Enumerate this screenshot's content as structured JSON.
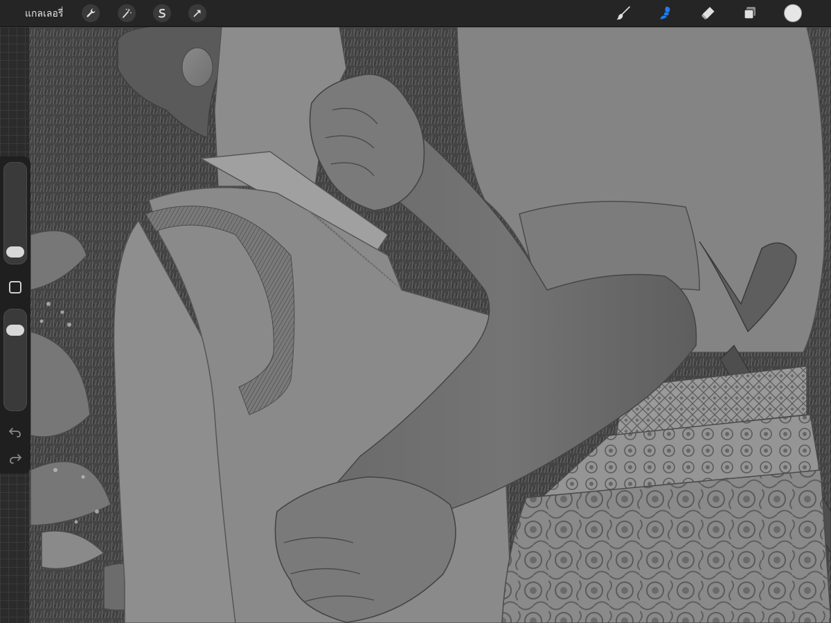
{
  "toolbar": {
    "gallery_label": "แกลเลอรี่",
    "left_tools": [
      "wrench-icon",
      "magic-wand-icon",
      "selection-icon",
      "transform-arrow-icon"
    ],
    "right_tools": [
      "brush-icon",
      "smudge-icon",
      "eraser-icon",
      "layers-icon"
    ],
    "active_tool": "smudge-icon",
    "accent_color": "#1f7cf5",
    "current_color": "#e6e6e6"
  },
  "sidebar": {
    "brush_size_level": 0.05,
    "opacity_level": 0.85,
    "controls": [
      "brush-size-slider",
      "modify-button",
      "opacity-slider",
      "undo-button",
      "redo-button"
    ]
  }
}
